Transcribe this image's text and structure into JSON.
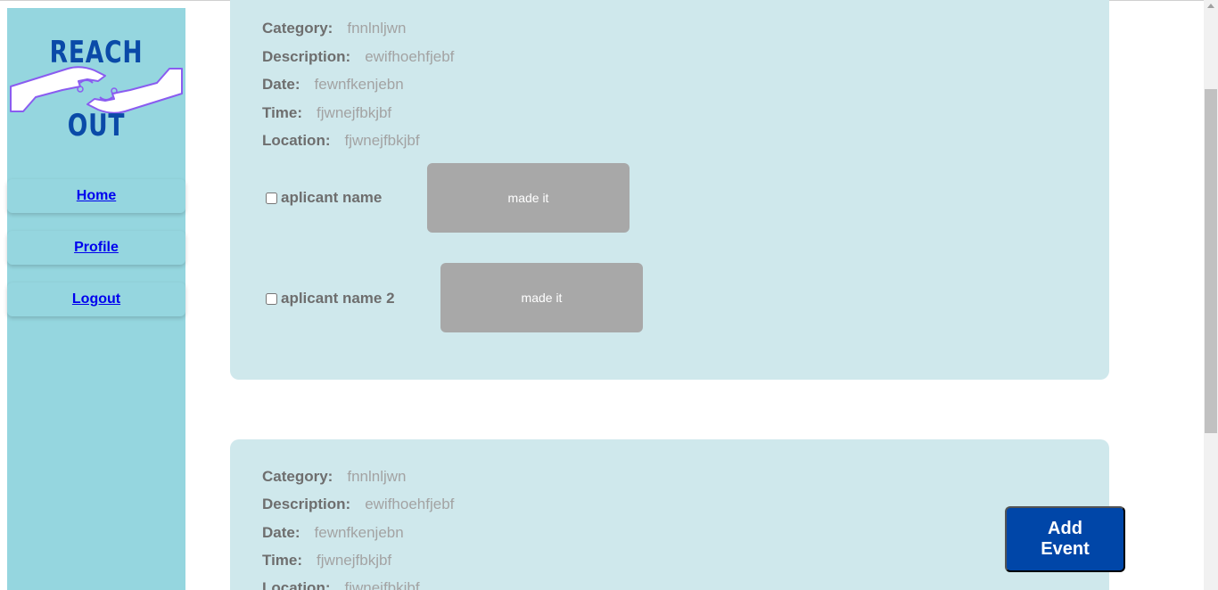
{
  "sidebar": {
    "logo": {
      "top": "REACH",
      "bottom": "OUT"
    },
    "nav": [
      {
        "label": "Home"
      },
      {
        "label": "Profile"
      },
      {
        "label": "Logout"
      }
    ]
  },
  "events": [
    {
      "fields": {
        "category": {
          "label": "Category:",
          "value": "fnnlnljwn"
        },
        "description": {
          "label": "Description:",
          "value": "ewifhoehfjebf"
        },
        "date": {
          "label": "Date:",
          "value": "fewnfkenjebn"
        },
        "time": {
          "label": "Time:",
          "value": "fjwnejfbkjbf"
        },
        "location": {
          "label": "Location:",
          "value": "fjwnejfbkjbf"
        }
      },
      "applicants": [
        {
          "name": "aplicant name",
          "button": "made it"
        },
        {
          "name": "aplicant name 2",
          "button": "made it"
        }
      ]
    },
    {
      "fields": {
        "category": {
          "label": "Category:",
          "value": "fnnlnljwn"
        },
        "description": {
          "label": "Description:",
          "value": "ewifhoehfjebf"
        },
        "date": {
          "label": "Date:",
          "value": "fewnfkenjebn"
        },
        "time": {
          "label": "Time:",
          "value": "fjwnejfbkjbf"
        },
        "location": {
          "label": "Location:",
          "value": "fjwnejfbkjbf"
        }
      }
    }
  ],
  "add_event_label": "Add Event",
  "colors": {
    "sidebar": "#95d6df",
    "card": "#cfe8ec",
    "brand": "#0a4aa8",
    "add_button": "#0046a8",
    "made_button": "#a8a8a8"
  }
}
